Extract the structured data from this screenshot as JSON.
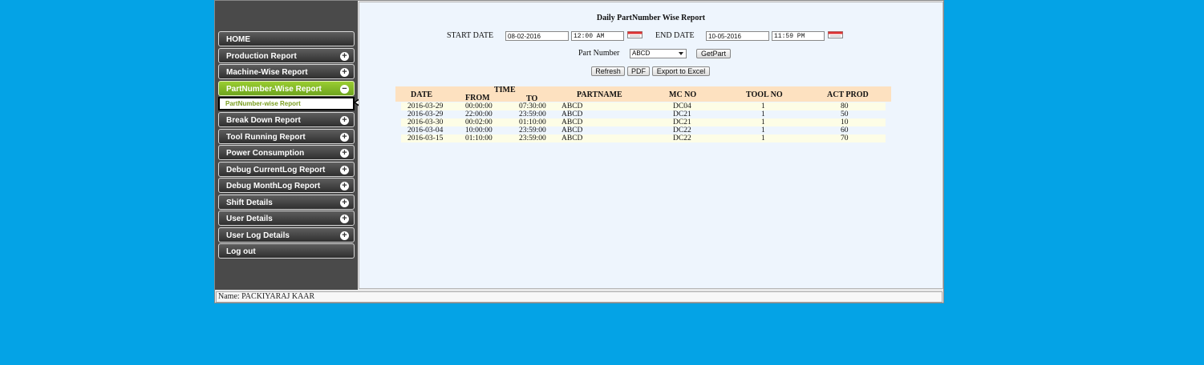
{
  "sidebar": {
    "items": [
      {
        "label": "HOME",
        "expand": ""
      },
      {
        "label": "Production Report",
        "expand": "+"
      },
      {
        "label": "Machine-Wise Report",
        "expand": "+"
      },
      {
        "label": "PartNumber-Wise Report",
        "expand": "−",
        "active": true
      },
      {
        "label": "Break Down Report",
        "expand": "+"
      },
      {
        "label": "Tool Running Report",
        "expand": "+"
      },
      {
        "label": "Power Consumption",
        "expand": "+"
      },
      {
        "label": "Debug CurrentLog Report",
        "expand": "+"
      },
      {
        "label": "Debug MonthLog Report",
        "expand": "+"
      },
      {
        "label": "Shift Details",
        "expand": "+"
      },
      {
        "label": "User Details",
        "expand": "+"
      },
      {
        "label": "User Log Details",
        "expand": "+"
      },
      {
        "label": "Log out",
        "expand": ""
      }
    ],
    "subitem": "PartNumber-wise Report"
  },
  "report": {
    "title": "Daily PartNumber Wise Report",
    "start_label": "START DATE",
    "start_date": "08-02-2016",
    "start_time": "12:00 AM",
    "end_label": "END DATE",
    "end_date": "10-05-2016",
    "end_time": "11:59 PM",
    "part_label": "Part Number",
    "part_value": "ABCD",
    "getpart_label": "GetPart",
    "refresh_label": "Refresh",
    "pdf_label": "PDF",
    "excel_label": "Export to Excel"
  },
  "table": {
    "headers": {
      "date": "DATE",
      "time": "TIME",
      "from": "FROM",
      "to": "TO",
      "partname": "PARTNAME",
      "mcno": "MC NO",
      "toolno": "TOOL NO",
      "actprod": "ACT PROD"
    },
    "rows": [
      {
        "date": "2016-03-29",
        "from": "00:00:00",
        "to": "07:30:00",
        "partname": "ABCD",
        "mcno": "DC04",
        "toolno": "1",
        "actprod": "80"
      },
      {
        "date": "2016-03-29",
        "from": "22:00:00",
        "to": "23:59:00",
        "partname": "ABCD",
        "mcno": "DC21",
        "toolno": "1",
        "actprod": "50"
      },
      {
        "date": "2016-03-30",
        "from": "00:02:00",
        "to": "01:10:00",
        "partname": "ABCD",
        "mcno": "DC21",
        "toolno": "1",
        "actprod": "10"
      },
      {
        "date": "2016-03-04",
        "from": "10:00:00",
        "to": "23:59:00",
        "partname": "ABCD",
        "mcno": "DC22",
        "toolno": "1",
        "actprod": "60"
      },
      {
        "date": "2016-03-15",
        "from": "01:10:00",
        "to": "23:59:00",
        "partname": "ABCD",
        "mcno": "DC22",
        "toolno": "1",
        "actprod": "70"
      }
    ]
  },
  "footer": {
    "name": "Name: PACKIYARAJ KAAR"
  },
  "colors": {
    "background": "#04a3e6",
    "sidebar": "#4a4a4a",
    "active": "#8cc43a",
    "table_header": "#fde1c0"
  }
}
